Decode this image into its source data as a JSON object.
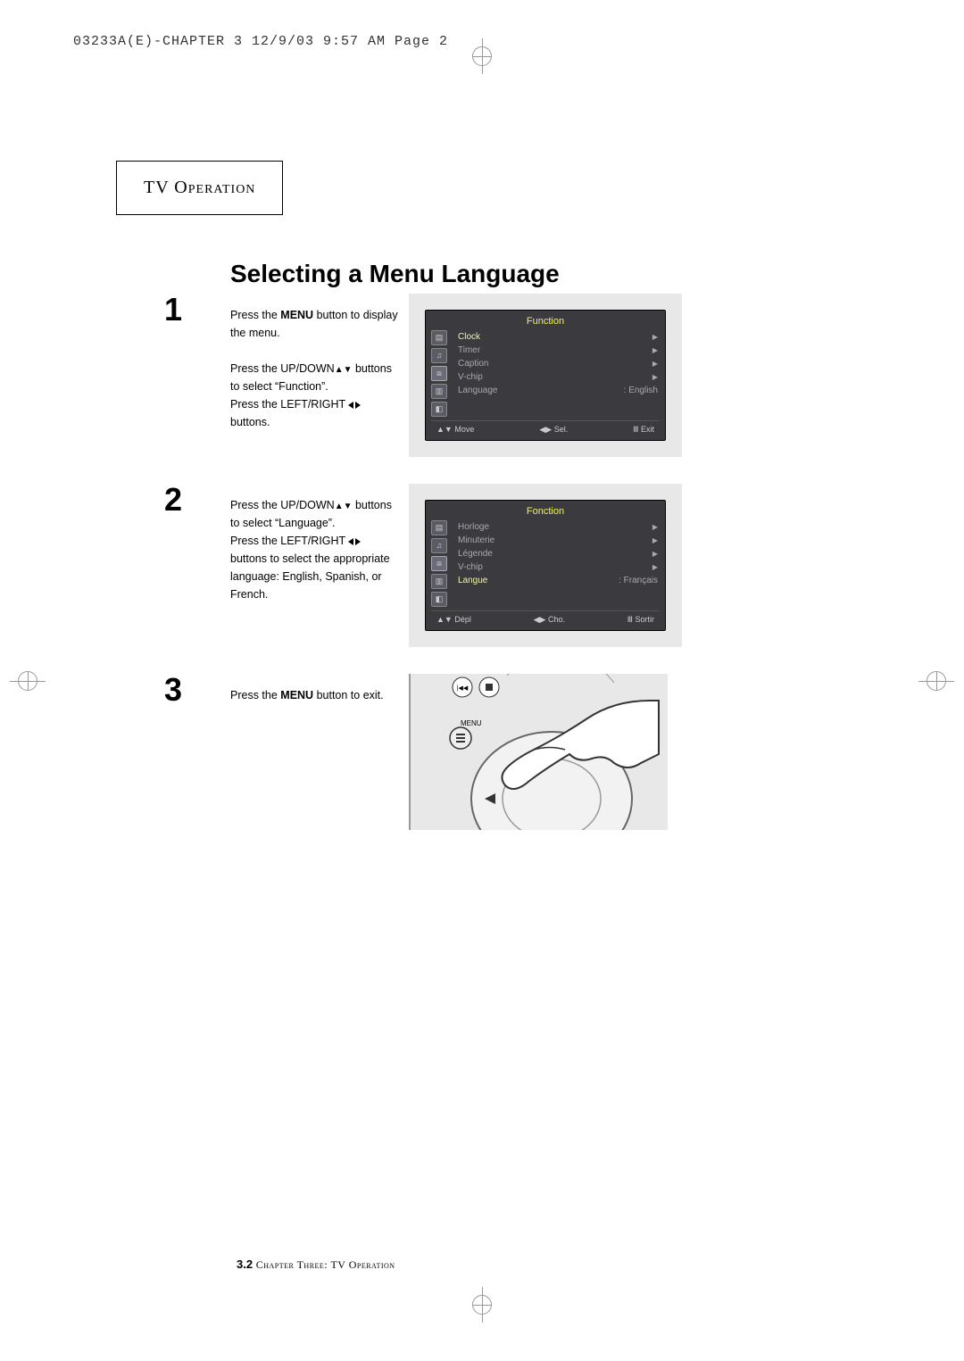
{
  "header": {
    "source_line": "03233A(E)-CHAPTER 3  12/9/03  9:57 AM  Page 2"
  },
  "section_box": "TV Operation",
  "page_title": "Selecting a Menu Language",
  "steps": [
    {
      "num": "1",
      "paragraphs": [
        {
          "prefix": "Press the ",
          "bold": "MENU",
          "suffix": " button to display the menu."
        },
        {
          "plain": "Press the UP/DOWN",
          "arrows": "ud",
          "tail": " buttons to select “Function”."
        },
        {
          "plain": "Press the LEFT/RIGHT ",
          "arrows": "lr",
          "tail": " buttons."
        }
      ]
    },
    {
      "num": "2",
      "paragraphs": [
        {
          "plain": "Press the UP/DOWN",
          "arrows": "ud",
          "tail": " buttons to select “Language”."
        },
        {
          "plain": "Press the LEFT/RIGHT ",
          "arrows": "lr",
          "tail": " buttons to select the appropriate language: English, Spanish, or French."
        }
      ]
    },
    {
      "num": "3",
      "paragraphs": [
        {
          "prefix": "Press the ",
          "bold": "MENU",
          "suffix": " button to exit."
        }
      ]
    }
  ],
  "osd1": {
    "title": "Function",
    "items": [
      {
        "label": "Clock",
        "value": "",
        "arrow": true,
        "hl": true
      },
      {
        "label": "Timer",
        "value": "",
        "arrow": true
      },
      {
        "label": "Caption",
        "value": "",
        "arrow": true
      },
      {
        "label": "V-chip",
        "value": "",
        "arrow": true
      },
      {
        "label": "Language",
        "value": ": English",
        "arrow": false
      }
    ],
    "footer": {
      "move": "Move",
      "sel": "Sel.",
      "exit": "Exit"
    }
  },
  "osd2": {
    "title": "Fonction",
    "items": [
      {
        "label": "Horloge",
        "value": "",
        "arrow": true
      },
      {
        "label": "Minuterie",
        "value": "",
        "arrow": true
      },
      {
        "label": "Légende",
        "value": "",
        "arrow": true
      },
      {
        "label": "V-chip",
        "value": "",
        "arrow": true
      },
      {
        "label": "Langue",
        "value": ": Français",
        "arrow": false,
        "hl": true
      }
    ],
    "footer": {
      "move": "Dépl",
      "sel": "Cho.",
      "exit": "Sortir"
    }
  },
  "remote": {
    "menu_label": "MENU"
  },
  "footer": {
    "page_num": "3.2",
    "chapter": "Chapter Three: TV Operation"
  }
}
